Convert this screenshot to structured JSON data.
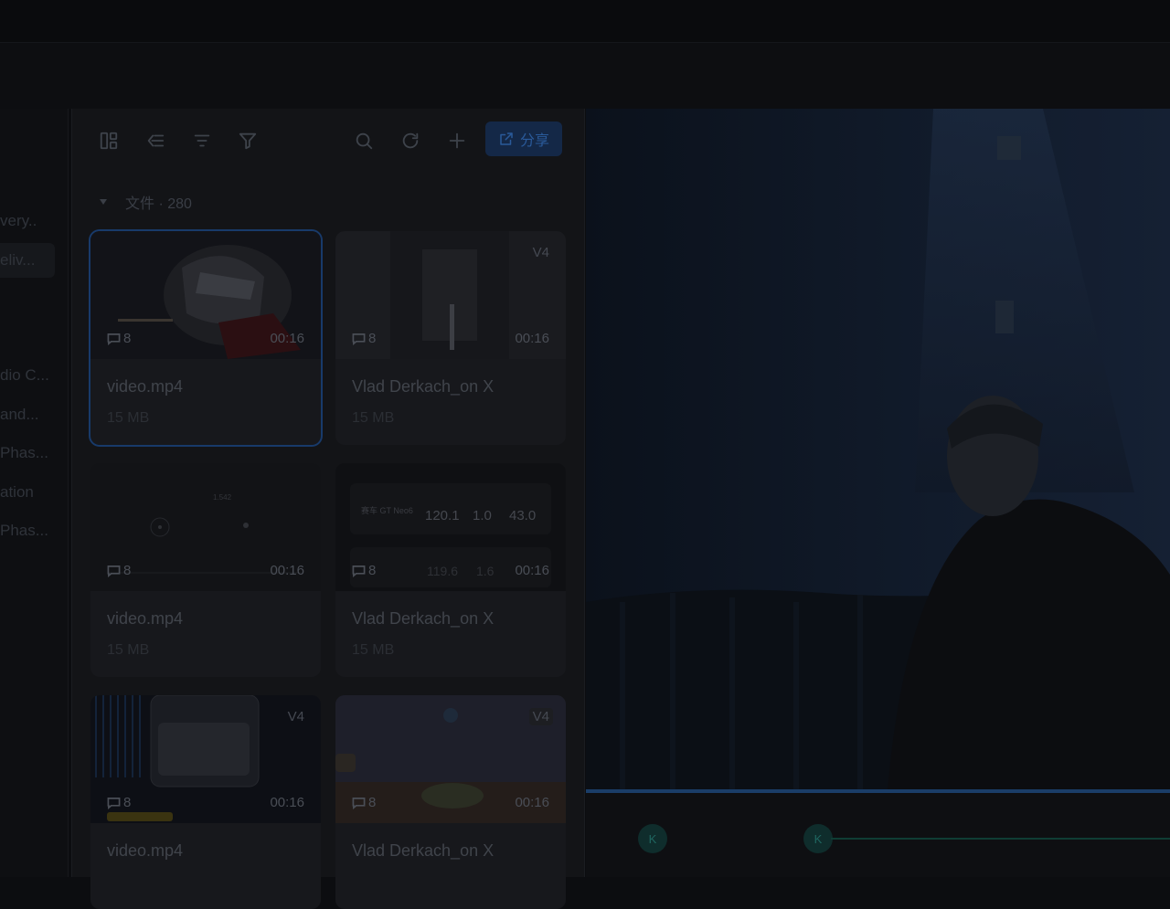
{
  "sidebar": {
    "items": [
      {
        "label": "very..",
        "active": false
      },
      {
        "label": "eliv...",
        "active": true
      },
      {
        "label": "dio C...",
        "active": false
      },
      {
        "label": "and...",
        "active": false
      },
      {
        "label": "Phas...",
        "active": false
      },
      {
        "label": "ation",
        "active": false
      },
      {
        "label": "Phas...",
        "active": false
      }
    ]
  },
  "toolbar": {
    "icons": [
      "layout-icon",
      "collapse-icon",
      "sort-icon",
      "filter-icon",
      "search-icon",
      "refresh-icon",
      "add-icon"
    ],
    "share_label": "分享",
    "share_color": "#142847"
  },
  "files": {
    "section_label": "文件 · 280",
    "items": [
      {
        "title": "video.mp4",
        "size": "15 MB",
        "comments": "8",
        "duration": "00:16",
        "version": "",
        "selected": true
      },
      {
        "title": "Vlad Derkach_on X",
        "size": "15 MB",
        "comments": "8",
        "duration": "00:16",
        "version": "V4",
        "selected": false
      },
      {
        "title": "video.mp4",
        "size": "15 MB",
        "comments": "8",
        "duration": "00:16",
        "version": "",
        "selected": false
      },
      {
        "title": "Vlad Derkach_on X",
        "size": "15 MB",
        "comments": "8",
        "duration": "00:16",
        "version": "",
        "selected": false
      },
      {
        "title": "video.mp4",
        "size": "",
        "comments": "8",
        "duration": "00:16",
        "version": "V4",
        "selected": false
      },
      {
        "title": "Vlad Derkach_on X",
        "size": "",
        "comments": "8",
        "duration": "00:16",
        "version": "V4",
        "selected": false
      }
    ],
    "telemetry": {
      "name": "赛车 GT Neo6",
      "row1": [
        "120.1",
        "1.0",
        "43.0"
      ],
      "row2": [
        "119.6",
        "1.6"
      ]
    },
    "thumb_top_label": "1.542"
  },
  "timeline": {
    "markers": [
      "K",
      "K"
    ],
    "accent": "#1a3d68"
  }
}
